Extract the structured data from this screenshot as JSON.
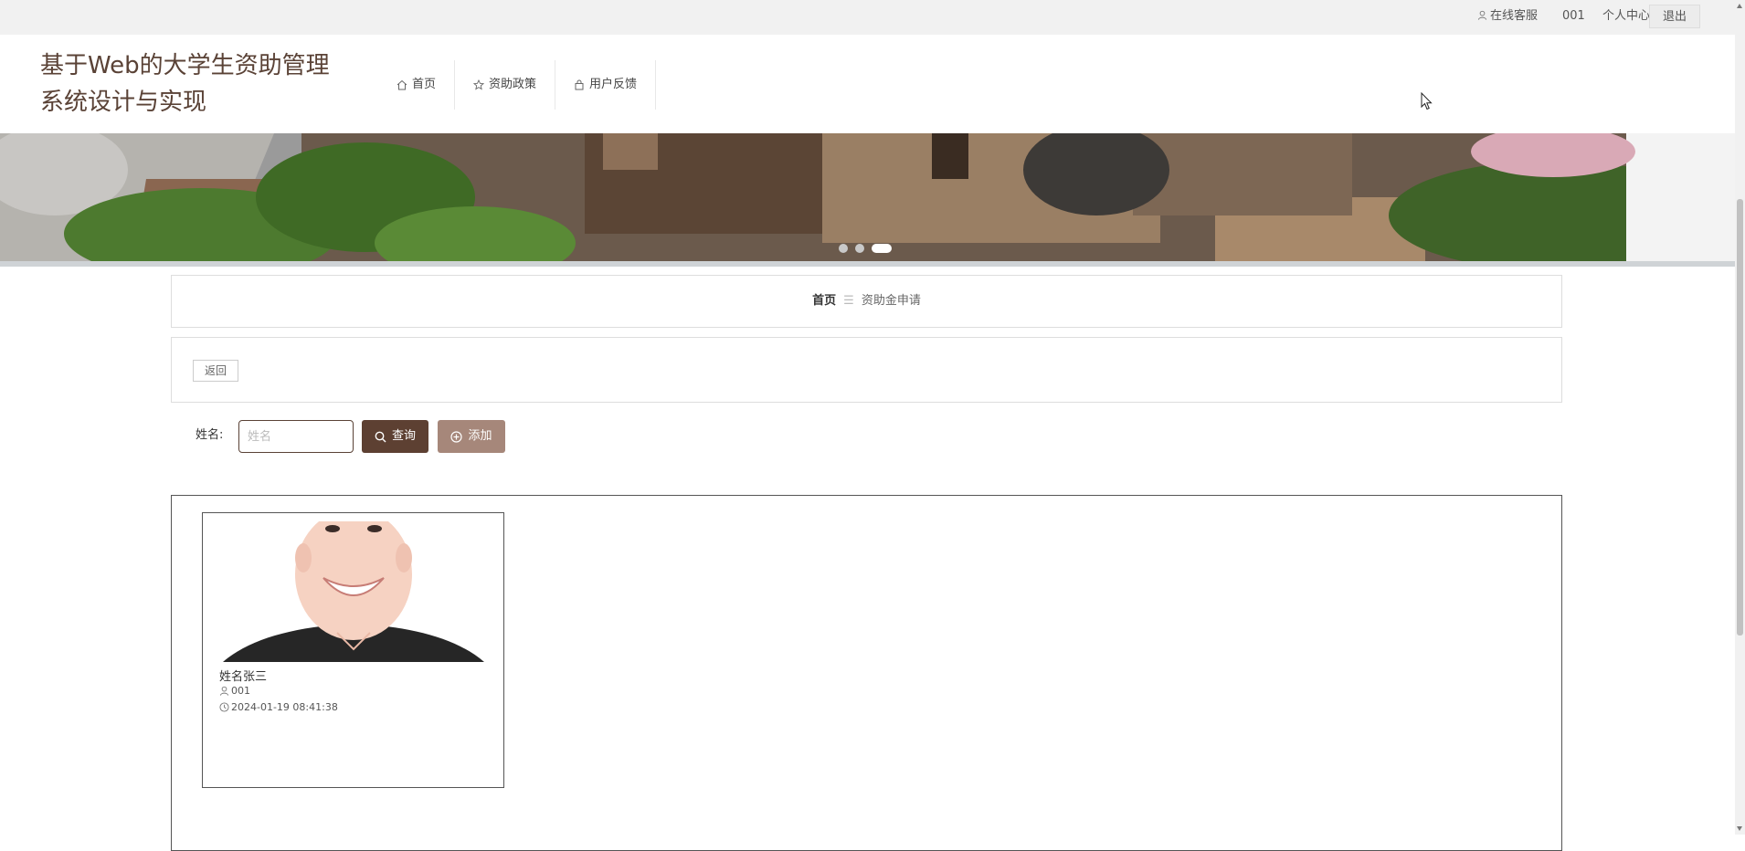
{
  "topbar": {
    "service_label": "在线客服",
    "username": "001",
    "profile_label": "个人中心",
    "logout_label": "退出"
  },
  "header": {
    "title": "基于Web的大学生资助管理系统设计与实现",
    "nav": [
      {
        "label": "首页",
        "icon": "home-icon"
      },
      {
        "label": "资助政策",
        "icon": "star-icon"
      },
      {
        "label": "用户反馈",
        "icon": "bag-icon"
      }
    ]
  },
  "banner": {
    "slides": 3,
    "active_slide": 3
  },
  "breadcrumb": {
    "home": "首页",
    "separator": "☰",
    "current": "资助金申请"
  },
  "actions": {
    "back_label": "返回"
  },
  "search": {
    "label": "姓名:",
    "placeholder": "姓名",
    "value": "",
    "search_label": "查询",
    "add_label": "添加"
  },
  "colors": {
    "brand": "#5d4032",
    "add_button": "#a6877a",
    "title": "#5a4236"
  },
  "records": [
    {
      "name": "姓名张三",
      "account": "001",
      "time": "2024-01-19 08:41:38"
    }
  ]
}
